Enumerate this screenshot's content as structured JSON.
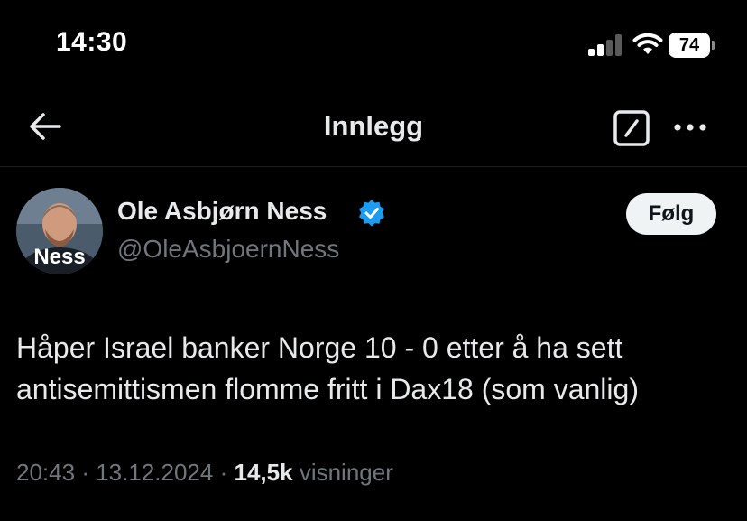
{
  "status_bar": {
    "time": "14:30",
    "battery_level": "74",
    "icons": [
      "cellular-signal-icon",
      "wifi-icon",
      "battery-icon"
    ]
  },
  "header": {
    "title": "Innlegg",
    "icons": [
      "back-arrow-icon",
      "edit-icon",
      "more-icon"
    ]
  },
  "post": {
    "author_name": "Ole Asbjørn Ness",
    "handle": "@OleAsbjoernNess",
    "avatar_text": "Ness",
    "verified": true,
    "follow_label": "Følg",
    "text_line1": "Håper Israel banker Norge 10 - 0 etter å ha sett",
    "text_line2": "antisemittismen flomme fritt i Dax18 (som vanlig)",
    "time": "20:43",
    "separator": "·",
    "date": "13.12.2024",
    "views_count": "14,5k",
    "views_label": "visninger"
  },
  "colors": {
    "background": "#000000",
    "text_primary": "#e7e9ea",
    "text_secondary": "#71767b",
    "verified_blue": "#1d9bf0",
    "follow_button_bg": "#eff3f4"
  }
}
